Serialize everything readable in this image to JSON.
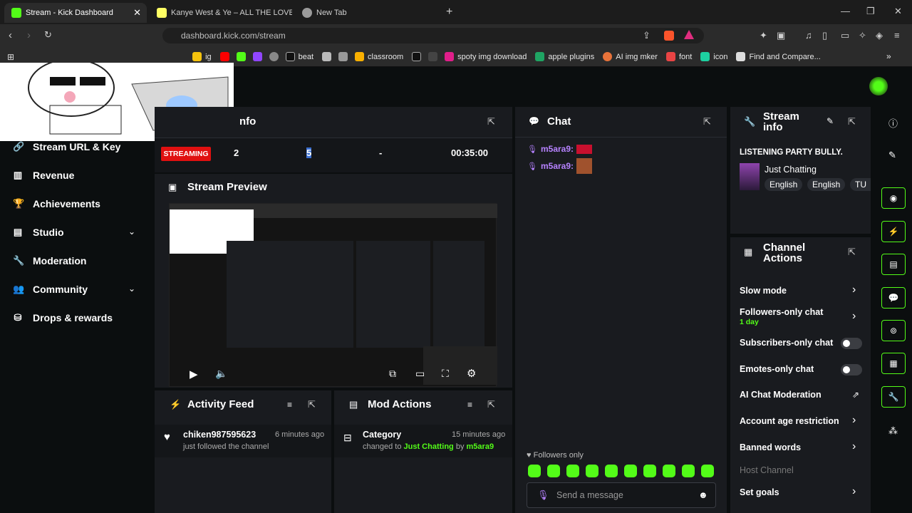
{
  "browser": {
    "tabs": [
      {
        "label": "Stream - Kick Dashboard",
        "favicon_color": "#53fc18"
      },
      {
        "label": "Kanye West & Ye – ALL THE LOVE Lyr",
        "favicon_color": "#ffff64"
      },
      {
        "label": "New Tab",
        "favicon_color": "#9b9b9b"
      }
    ],
    "url": "dashboard.kick.com/stream",
    "bookmarks": [
      "ig",
      "beat",
      "classroom",
      "spoty img download",
      "apple plugins",
      "AI img mker",
      "font",
      "icon",
      "Find and Compare..."
    ]
  },
  "sidebar": {
    "items": [
      {
        "label": "Stream URL & Key",
        "icon": "link-icon"
      },
      {
        "label": "Revenue",
        "icon": "chart-icon"
      },
      {
        "label": "Achievements",
        "icon": "trophy-icon"
      },
      {
        "label": "Studio",
        "icon": "studio-icon",
        "expandable": true
      },
      {
        "label": "Moderation",
        "icon": "wrench-icon"
      },
      {
        "label": "Community",
        "icon": "community-icon",
        "expandable": true
      },
      {
        "label": "Drops & rewards",
        "icon": "drops-icon"
      }
    ]
  },
  "session": {
    "title_fragment": "nfo",
    "status": "STREAMING",
    "viewers": "2",
    "followers": "5",
    "subs": "-",
    "time": "00:35:00"
  },
  "preview": {
    "title": "Stream Preview"
  },
  "activity": {
    "title": "Activity Feed",
    "user": "chiken987595623",
    "text": "just followed the channel",
    "time": "6 minutes ago"
  },
  "mod_actions": {
    "title": "Mod Actions",
    "label": "Category",
    "time": "15 minutes ago",
    "changed_to": "changed to",
    "category": "Just Chatting",
    "by": "by",
    "user": "m5ara9"
  },
  "chat": {
    "title": "Chat",
    "messages": [
      {
        "user": "m5ara9:"
      },
      {
        "user": "m5ara9:"
      }
    ],
    "followers_only": "Followers only",
    "placeholder": "Send a message"
  },
  "stream_info": {
    "title_line1": "Stream",
    "title_line2": "info",
    "stream_title": "LISTENING PARTY BULLY.",
    "category": "Just Chatting",
    "tags": [
      "English",
      "English",
      "TU"
    ]
  },
  "channel_actions": {
    "title_line1": "Channel",
    "title_line2": "Actions",
    "slow_mode": "Slow mode",
    "followers_only": "Followers-only chat",
    "followers_duration": "1 day",
    "subscribers_only": "Subscribers-only chat",
    "emotes_only": "Emotes-only chat",
    "ai_moderation": "AI Chat Moderation",
    "account_age": "Account age restriction",
    "banned_words": "Banned words",
    "host_channel": "Host Channel",
    "set_goals": "Set goals"
  },
  "colors": {
    "accent": "#53fc18",
    "streaming": "#e01010",
    "panel": "#191b1f"
  }
}
